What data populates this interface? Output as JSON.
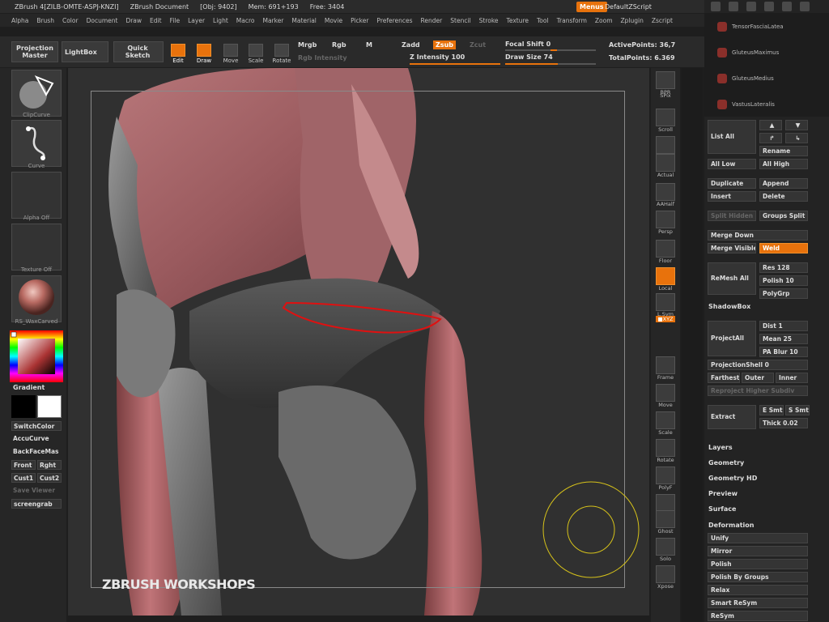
{
  "titlebar": {
    "app": "ZBrush 4[ZILB-OMTE-ASPJ-KNZI]",
    "doc": "ZBrush Document",
    "obj": "[Obj: 9402]",
    "mem": "Mem: 691+193",
    "free": "Free: 3404",
    "menus_btn": "Menus",
    "script": "DefaultZScript"
  },
  "menubar": [
    "Alpha",
    "Brush",
    "Color",
    "Document",
    "Draw",
    "Edit",
    "File",
    "Layer",
    "Light",
    "Macro",
    "Marker",
    "Material",
    "Movie",
    "Picker",
    "Preferences",
    "Render",
    "Stencil",
    "Stroke",
    "Texture",
    "Tool",
    "Transform",
    "Zoom",
    "Zplugin",
    "Zscript"
  ],
  "topshelf": {
    "projection_master": "Projection Master",
    "lightbox": "LightBox",
    "quick_sketch": "Quick Sketch",
    "edit": "Edit",
    "draw": "Draw",
    "move": "Move",
    "scale": "Scale",
    "rotate": "Rotate",
    "mrgb": "Mrgb",
    "rgb": "Rgb",
    "m": "M",
    "rgb_intensity": "Rgb Intensity",
    "zadd": "Zadd",
    "zsub": "Zsub",
    "zcut": "Zcut",
    "z_intensity_label": "Z Intensity",
    "z_intensity_value": "100",
    "focal_shift_label": "Focal Shift",
    "focal_shift_value": "0",
    "draw_size_label": "Draw Size",
    "draw_size_value": "74",
    "active_points": "ActivePoints: 36,7",
    "total_points": "TotalPoints: 6.369"
  },
  "leftshelf": {
    "clipcurve": "ClipCurve",
    "curve": "Curve",
    "alpha_off": "Alpha  Off",
    "texture_off": "Texture  Off",
    "material": "RS_WaxCarved",
    "gradient": "Gradient",
    "switchcolor": "SwitchColor",
    "accucurve": "AccuCurve",
    "backfacemask": "BackFaceMas",
    "front": "Front",
    "right": "Rght",
    "cust1": "Cust1",
    "cust2": "Cust2",
    "save_viewer": "Save Viewer",
    "screengrab": "screengrab"
  },
  "viewport": {
    "watermark": "ZBRUSH WORKSHOPS"
  },
  "rightshelf": {
    "bpr": "BPR",
    "spix": "SPix",
    "scroll": "Scroll",
    "zoom": "Zoom",
    "actual": "Actual",
    "aahalf": "AAHalf",
    "persp": "Persp",
    "floor": "Floor",
    "local": "Local",
    "lsym": "L.Sym",
    "xyz": "■XYZ",
    "frame": "Frame",
    "move": "Move",
    "scale": "Scale",
    "rotate": "Rotate",
    "polyf": "PolyF",
    "transp": "Transp",
    "ghost": "Ghost",
    "solo": "Solo",
    "xpose": "Xpose"
  },
  "tray": {
    "subtools": [
      "TensorFasciaLatea",
      "GluteusMaximus",
      "GluteusMedius",
      "VastusLateralis"
    ],
    "list_all": "List All",
    "rename": "Rename",
    "all_low": "All Low",
    "all_high": "All High",
    "duplicate": "Duplicate",
    "append": "Append",
    "insert": "Insert",
    "delete": "Delete",
    "split_hidden": "Split Hidden",
    "groups_split": "Groups Split",
    "merge_down": "Merge Down",
    "merge_visible": "Merge Visible",
    "weld": "Weld",
    "remesh_all": "ReMesh All",
    "res": "Res 128",
    "polish": "Polish 10",
    "polygrp": "PolyGrp",
    "shadowbox": "ShadowBox",
    "project_all": "ProjectAll",
    "dist": "Dist 1",
    "mean": "Mean 25",
    "pa_blur": "PA Blur 10",
    "projection_shell": "ProjectionShell 0",
    "farthest": "Farthest",
    "outer": "Outer",
    "inner": "Inner",
    "reproject_higher": "Reproject Higher Subdiv",
    "extract": "Extract",
    "e_smt": "E Smt",
    "s_smt": "S Smt",
    "thick": "Thick 0.02",
    "layers": "Layers",
    "geometry": "Geometry",
    "geometry_hd": "Geometry HD",
    "preview": "Preview",
    "surface": "Surface",
    "deformation": "Deformation",
    "deform_items": [
      "Unify",
      "Mirror",
      "Polish",
      "Polish By Groups",
      "Relax",
      "Smart ReSym",
      "ReSym"
    ]
  },
  "colors": {
    "accent": "#e8720c",
    "bg": "#1e1e1e"
  }
}
